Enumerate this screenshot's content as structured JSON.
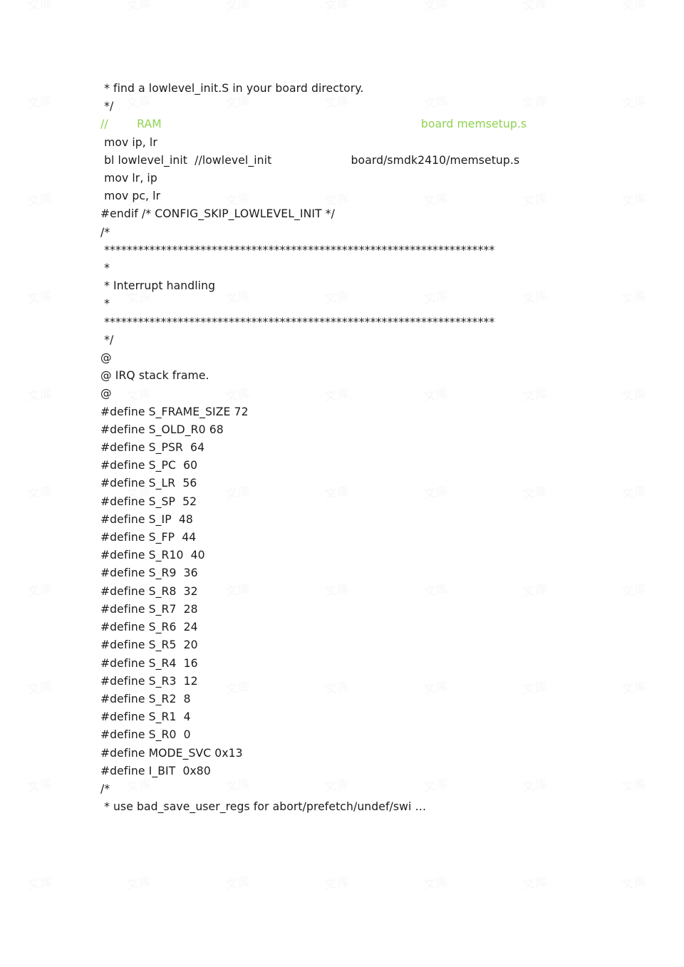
{
  "document": {
    "type": "source-code-listing",
    "language": "ARM assembly (GNU as)",
    "colors": {
      "text": "#1b1b1b",
      "comment_green": "#8ed24f",
      "background": "#ffffff",
      "watermark": "#f7f7f8"
    },
    "watermark": {
      "glyphs": "文库",
      "columns": 7,
      "rows": 10
    },
    "lines": [
      {
        "id": "l01",
        "style": "plain",
        "text": " * find a lowlevel_init.S in your board directory."
      },
      {
        "id": "l02",
        "style": "plain",
        "text": " */"
      },
      {
        "id": "l03",
        "style": "comment-green",
        "text": "//        RAM                                                                        board memsetup.s"
      },
      {
        "id": "l04",
        "style": "plain",
        "text": " mov ip, lr"
      },
      {
        "id": "l05",
        "style": "plain",
        "text": " bl lowlevel_init  //lowlevel_init                      board/smdk2410/memsetup.s"
      },
      {
        "id": "l06",
        "style": "plain",
        "text": " mov lr, ip"
      },
      {
        "id": "l07",
        "style": "plain",
        "text": " mov pc, lr"
      },
      {
        "id": "l08",
        "style": "plain",
        "text": "#endif /* CONFIG_SKIP_LOWLEVEL_INIT */"
      },
      {
        "id": "l09",
        "style": "plain",
        "text": "/*"
      },
      {
        "id": "l10",
        "style": "stars",
        "text": " *********************************************************************"
      },
      {
        "id": "l11",
        "style": "plain",
        "text": " *"
      },
      {
        "id": "l12",
        "style": "plain",
        "text": " * Interrupt handling"
      },
      {
        "id": "l13",
        "style": "plain",
        "text": " *"
      },
      {
        "id": "l14",
        "style": "stars",
        "text": " *********************************************************************"
      },
      {
        "id": "l15",
        "style": "plain",
        "text": " */"
      },
      {
        "id": "l16",
        "style": "plain",
        "text": "@"
      },
      {
        "id": "l17",
        "style": "plain",
        "text": "@ IRQ stack frame."
      },
      {
        "id": "l18",
        "style": "plain",
        "text": "@"
      },
      {
        "id": "l19",
        "style": "plain",
        "text": "#define S_FRAME_SIZE 72"
      },
      {
        "id": "l20",
        "style": "plain",
        "text": "#define S_OLD_R0 68"
      },
      {
        "id": "l21",
        "style": "plain",
        "text": "#define S_PSR  64"
      },
      {
        "id": "l22",
        "style": "plain",
        "text": "#define S_PC  60"
      },
      {
        "id": "l23",
        "style": "plain",
        "text": "#define S_LR  56"
      },
      {
        "id": "l24",
        "style": "plain",
        "text": "#define S_SP  52"
      },
      {
        "id": "l25",
        "style": "plain",
        "text": "#define S_IP  48"
      },
      {
        "id": "l26",
        "style": "plain",
        "text": "#define S_FP  44"
      },
      {
        "id": "l27",
        "style": "plain",
        "text": "#define S_R10  40"
      },
      {
        "id": "l28",
        "style": "plain",
        "text": "#define S_R9  36"
      },
      {
        "id": "l29",
        "style": "plain",
        "text": "#define S_R8  32"
      },
      {
        "id": "l30",
        "style": "plain",
        "text": "#define S_R7  28"
      },
      {
        "id": "l31",
        "style": "plain",
        "text": "#define S_R6  24"
      },
      {
        "id": "l32",
        "style": "plain",
        "text": "#define S_R5  20"
      },
      {
        "id": "l33",
        "style": "plain",
        "text": "#define S_R4  16"
      },
      {
        "id": "l34",
        "style": "plain",
        "text": "#define S_R3  12"
      },
      {
        "id": "l35",
        "style": "plain",
        "text": "#define S_R2  8"
      },
      {
        "id": "l36",
        "style": "plain",
        "text": "#define S_R1  4"
      },
      {
        "id": "l37",
        "style": "plain",
        "text": "#define S_R0  0"
      },
      {
        "id": "l38",
        "style": "plain",
        "text": "#define MODE_SVC 0x13"
      },
      {
        "id": "l39",
        "style": "plain",
        "text": "#define I_BIT  0x80"
      },
      {
        "id": "l40",
        "style": "plain",
        "text": "/*"
      },
      {
        "id": "l41",
        "style": "plain",
        "text": " * use bad_save_user_regs for abort/prefetch/undef/swi …"
      }
    ]
  }
}
